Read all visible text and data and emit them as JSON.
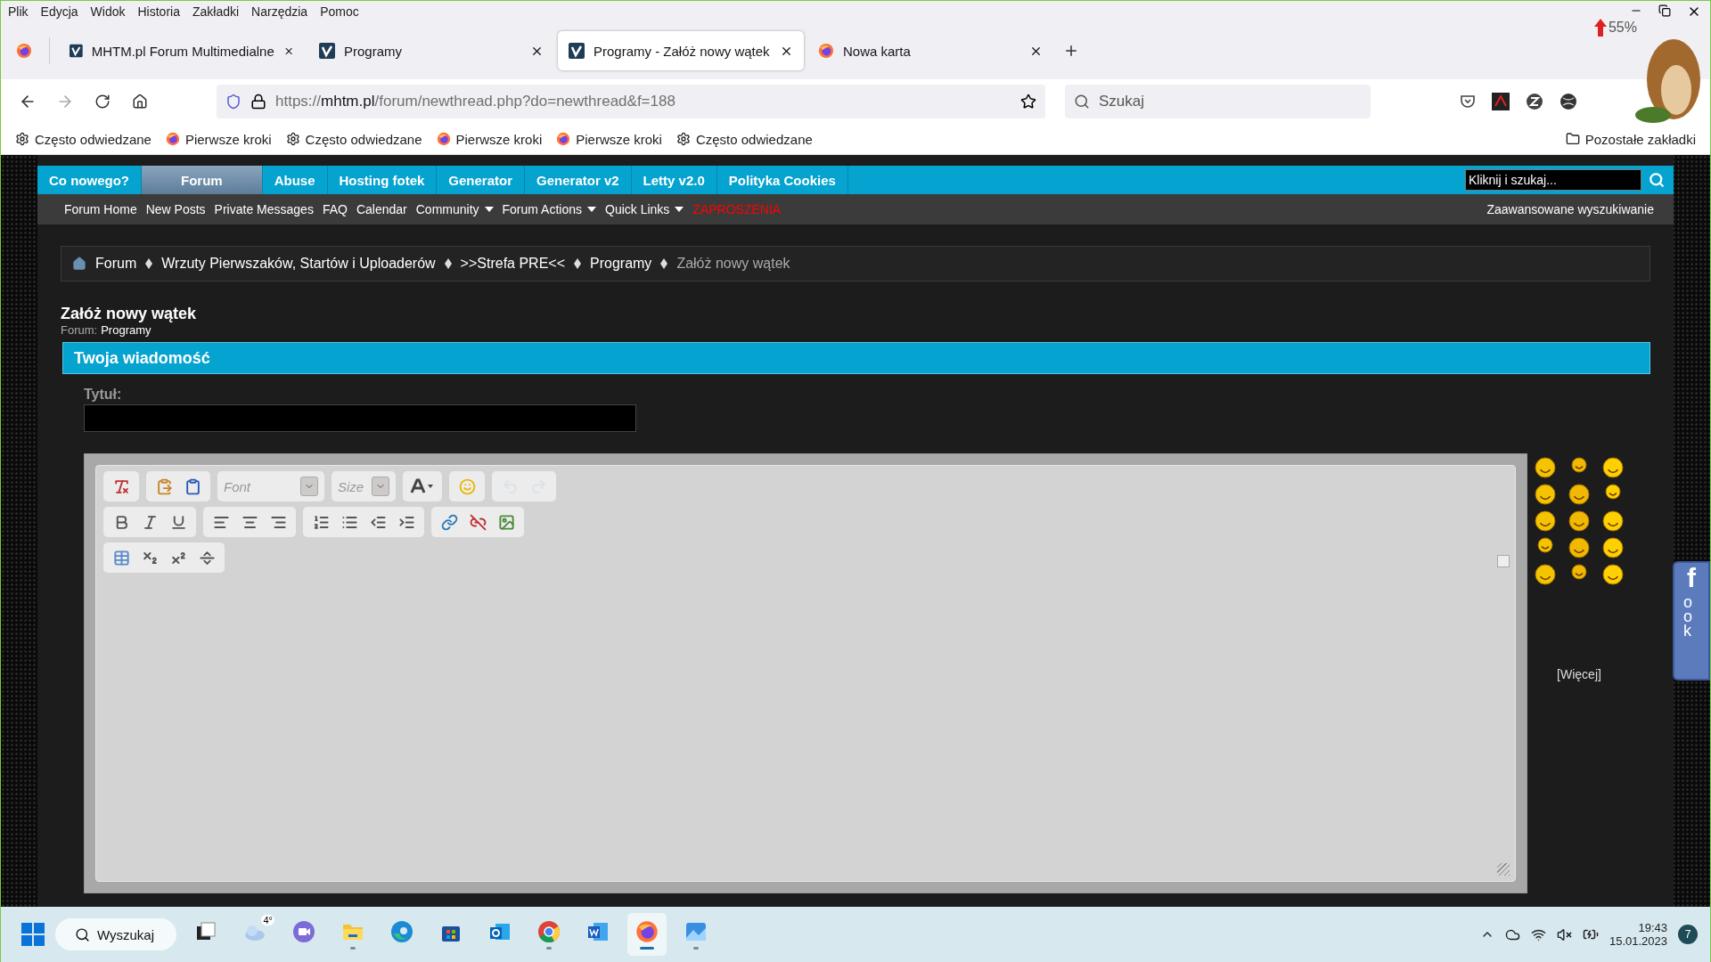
{
  "menu": [
    "Plik",
    "Edycja",
    "Widok",
    "Historia",
    "Zakładki",
    "Narzędzia",
    "Pomoc"
  ],
  "window_badge": "55%",
  "tabs": [
    {
      "label": "MHTM.pl Forum Multimedialne",
      "selected": false,
      "kind": "site"
    },
    {
      "label": "Programy",
      "selected": false,
      "kind": "site"
    },
    {
      "label": "Programy - Załóż nowy wątek",
      "selected": true,
      "kind": "site"
    },
    {
      "label": "Nowa karta",
      "selected": false,
      "kind": "firefox"
    }
  ],
  "address": {
    "prefix": "https://",
    "host": "mhtm.pl",
    "path": "/forum/newthread.php?do=newthread&f=188"
  },
  "search": {
    "placeholder": "Szukaj"
  },
  "bookmarks": [
    {
      "kind": "gear",
      "label": "Często odwiedzane"
    },
    {
      "kind": "firefox",
      "label": "Pierwsze kroki"
    },
    {
      "kind": "gear",
      "label": "Często odwiedzane"
    },
    {
      "kind": "firefox",
      "label": "Pierwsze kroki"
    },
    {
      "kind": "firefox",
      "label": "Pierwsze kroki"
    },
    {
      "kind": "gear",
      "label": "Często odwiedzane"
    }
  ],
  "other_bookmarks": "Pozostałe zakładki",
  "forum_nav": {
    "tabs": [
      {
        "label": "Co nowego?",
        "selected": false
      },
      {
        "label": "Forum",
        "selected": true
      },
      {
        "label": "Abuse",
        "selected": false
      },
      {
        "label": "Hosting fotek",
        "selected": false
      },
      {
        "label": "Generator",
        "selected": false
      },
      {
        "label": "Generator v2",
        "selected": false
      },
      {
        "label": "Letty v2.0",
        "selected": false
      },
      {
        "label": "Polityka Cookies",
        "selected": false
      }
    ],
    "search_placeholder": "Kliknij i szukaj..."
  },
  "sub_nav": {
    "items": [
      {
        "label": "Forum Home",
        "dropdown": false,
        "color": "#ffffff"
      },
      {
        "label": "New Posts",
        "dropdown": false,
        "color": "#ffffff"
      },
      {
        "label": "Private Messages",
        "dropdown": false,
        "color": "#ffffff"
      },
      {
        "label": "FAQ",
        "dropdown": false,
        "color": "#ffffff"
      },
      {
        "label": "Calendar",
        "dropdown": false,
        "color": "#ffffff"
      },
      {
        "label": "Community",
        "dropdown": true,
        "color": "#ffffff"
      },
      {
        "label": "Forum Actions",
        "dropdown": true,
        "color": "#ffffff"
      },
      {
        "label": "Quick Links",
        "dropdown": true,
        "color": "#ffffff"
      },
      {
        "label": "ZAPROSZENIA",
        "dropdown": false,
        "color": "#ff0000"
      }
    ],
    "advanced_search": "Zaawansowane wyszukiwanie"
  },
  "breadcrumb": [
    {
      "label": "Forum",
      "current": false
    },
    {
      "label": "Wrzuty Pierwszaków, Startów i Uploaderów",
      "current": false
    },
    {
      "label": ">>Strefa PRE<<",
      "current": false
    },
    {
      "label": "Programy",
      "current": false
    },
    {
      "label": "Załóż nowy wątek",
      "current": true
    }
  ],
  "page": {
    "title": "Załóż nowy wątek",
    "forum_label": "Forum:",
    "forum_name": "Programy"
  },
  "message": {
    "header": "Twoja wiadomość",
    "title_label": "Tytuł:"
  },
  "editor": {
    "font_placeholder": "Font",
    "size_placeholder": "Size",
    "toolbar": [
      [
        [
          {
            "kind": "removeformat",
            "disabled": false
          }
        ],
        [
          {
            "kind": "paste",
            "disabled": false
          },
          {
            "kind": "pasteword",
            "disabled": false
          }
        ],
        [
          {
            "kind": "font",
            "disabled": false
          }
        ],
        [
          {
            "kind": "size",
            "disabled": false
          }
        ],
        [
          {
            "kind": "color",
            "disabled": false
          }
        ],
        [
          {
            "kind": "smiley",
            "disabled": false
          }
        ],
        [
          {
            "kind": "undo",
            "disabled": true
          },
          {
            "kind": "redo",
            "disabled": true
          }
        ]
      ],
      [
        [
          {
            "kind": "bold",
            "disabled": false
          },
          {
            "kind": "italic",
            "disabled": false
          },
          {
            "kind": "underline",
            "disabled": false
          }
        ],
        [
          {
            "kind": "left",
            "disabled": false
          },
          {
            "kind": "center",
            "disabled": false
          },
          {
            "kind": "right",
            "disabled": false
          }
        ],
        [
          {
            "kind": "ol",
            "disabled": false
          },
          {
            "kind": "ul",
            "disabled": false
          },
          {
            "kind": "outdent",
            "disabled": false
          },
          {
            "kind": "indent",
            "disabled": false
          }
        ],
        [
          {
            "kind": "link",
            "disabled": false
          },
          {
            "kind": "unlink",
            "disabled": false
          },
          {
            "kind": "image",
            "disabled": false
          }
        ]
      ],
      [
        [
          {
            "kind": "table",
            "disabled": false
          },
          {
            "kind": "sub",
            "disabled": false
          },
          {
            "kind": "sup",
            "disabled": false
          },
          {
            "kind": "hr",
            "disabled": false
          }
        ]
      ]
    ]
  },
  "smilies": {
    "more": "[Więcej]"
  },
  "facebook": {
    "letter": "f",
    "text": "ook"
  },
  "taskbar": {
    "search": "Wyszukaj",
    "weather": "4°",
    "time": "19:43",
    "date": "15.01.2023",
    "notifications": "7",
    "apps": [
      {
        "kind": "taskview",
        "selected": false,
        "running": false
      },
      {
        "kind": "weather",
        "selected": false,
        "running": false
      },
      {
        "kind": "teams",
        "selected": false,
        "running": false
      },
      {
        "kind": "explorer",
        "selected": false,
        "running": true
      },
      {
        "kind": "edge",
        "selected": false,
        "running": false
      },
      {
        "kind": "store",
        "selected": false,
        "running": false
      },
      {
        "kind": "outlook",
        "selected": false,
        "running": false
      },
      {
        "kind": "chrome",
        "selected": false,
        "running": true
      },
      {
        "kind": "word",
        "selected": false,
        "running": false
      },
      {
        "kind": "firefox",
        "selected": true,
        "running": true
      },
      {
        "kind": "photos",
        "selected": false,
        "running": true
      }
    ]
  }
}
